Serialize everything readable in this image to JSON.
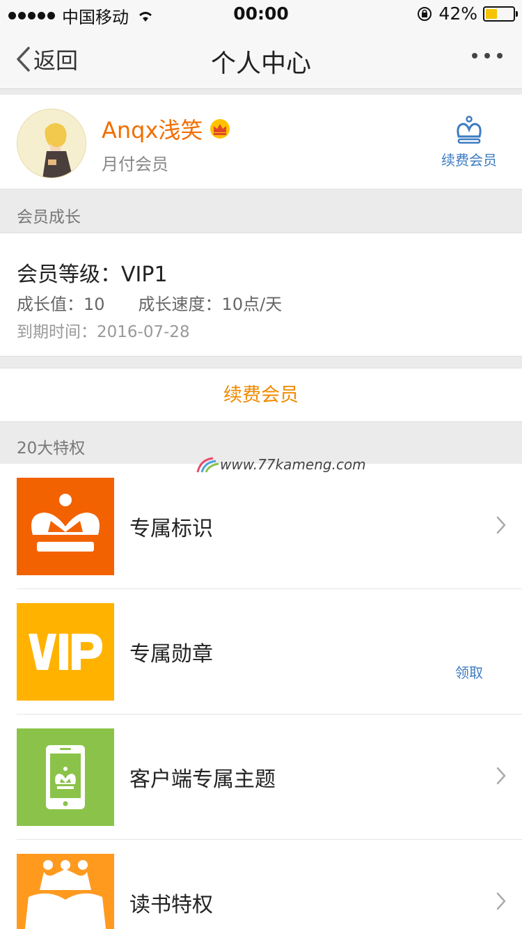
{
  "status_bar": {
    "carrier": "中国移动",
    "time": "00:00",
    "battery_percent": "42%",
    "battery_level": 0.42
  },
  "nav": {
    "back_label": "返回",
    "title": "个人中心"
  },
  "profile": {
    "username": "Anqx浅笑",
    "member_type": "月付会员",
    "renew_label": "续费会员"
  },
  "growth_section": {
    "header": "会员成长",
    "level_text": "会员等级：VIP1",
    "growth_value_text": "成长值：10",
    "growth_speed_text": "成长速度：10点/天",
    "expire_text": "到期时间：2016-07-28"
  },
  "renew_button": {
    "label": "续费会员"
  },
  "privileges": {
    "header": "20大特权",
    "items": [
      {
        "label": "专属标识",
        "icon": "crown-icon",
        "color": "#f26200"
      },
      {
        "label": "专属勋章",
        "icon": "vip-icon",
        "color": "#ffb300",
        "action": "领取"
      },
      {
        "label": "客户端专属主题",
        "icon": "phone-crown-icon",
        "color": "#8bc34a"
      },
      {
        "label": "读书特权",
        "icon": "book-crown-icon",
        "color": "#ff9a1f"
      }
    ]
  },
  "watermark": {
    "text": "www.77kameng.com"
  },
  "colors": {
    "accent_orange": "#f06e00",
    "link_blue": "#3c7cc2"
  }
}
